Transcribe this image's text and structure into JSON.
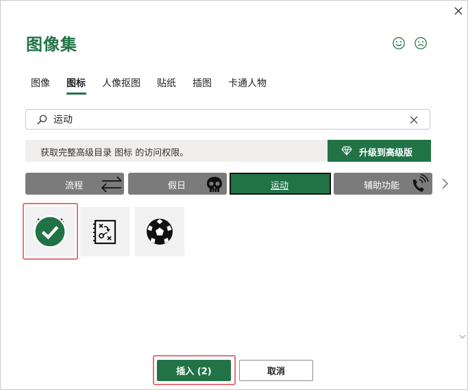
{
  "dialog": {
    "title": "图像集",
    "close_icon": "close-icon",
    "feedback": {
      "smile_icon": "smile-icon",
      "frown_icon": "frown-icon"
    }
  },
  "tabs": [
    {
      "label": "图像",
      "active": false
    },
    {
      "label": "图标",
      "active": true
    },
    {
      "label": "人像抠图",
      "active": false
    },
    {
      "label": "贴纸",
      "active": false
    },
    {
      "label": "插图",
      "active": false
    },
    {
      "label": "卡通人物",
      "active": false
    }
  ],
  "search": {
    "value": "运动",
    "icon": "search-icon",
    "clear_icon": "clear-icon"
  },
  "banner": {
    "text": "获取完整高级目录 图标 的访问权限。",
    "upgrade_label": "升级到高级版",
    "upgrade_icon": "diamond-icon"
  },
  "categories": [
    {
      "label": "流程",
      "icon": "swap-arrows-icon",
      "active": false
    },
    {
      "label": "假日",
      "icon": "skull-icon",
      "active": false
    },
    {
      "label": "运动",
      "icon": "",
      "active": true
    },
    {
      "label": "辅助功能",
      "icon": "phone-volume-icon",
      "active": false
    }
  ],
  "results": [
    {
      "icon": "weightlifter-icon",
      "selected": true
    },
    {
      "icon": "playbook-icon",
      "selected": false
    },
    {
      "icon": "soccer-ball-icon",
      "selected": false
    }
  ],
  "footer": {
    "insert_label": "插入 (2)",
    "cancel_label": "取消"
  },
  "colors": {
    "accent": "#217346",
    "category_bg": "#7b7b7b",
    "highlight": "#e76f7b"
  }
}
